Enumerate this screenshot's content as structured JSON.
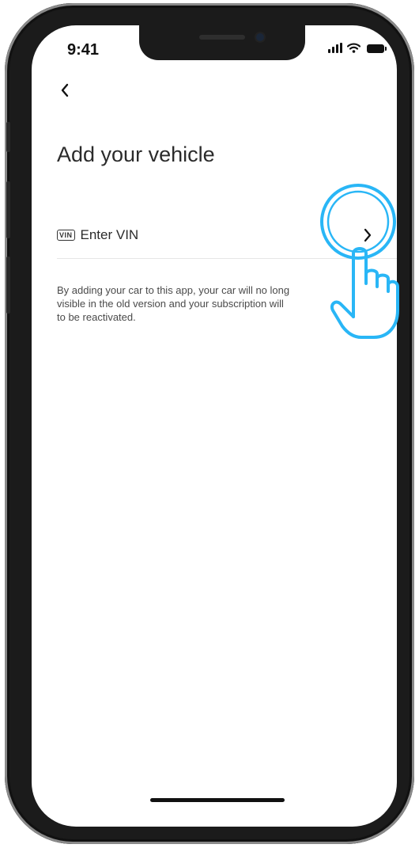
{
  "status_bar": {
    "time": "9:41",
    "icons": [
      "cellular-signal-icon",
      "wifi-icon",
      "battery-icon"
    ]
  },
  "header": {
    "back_icon": "chevron-left-icon",
    "title": "Add your vehicle"
  },
  "vin_row": {
    "badge": "VIN",
    "label": "Enter VIN",
    "chevron_icon": "chevron-right-icon"
  },
  "info": {
    "text": "By adding your car to this app, your car will no long\nvisible in the old version and your subscription will\nto be reactivated."
  },
  "overlay": {
    "tap_hint_icon": "tap-hand-icon",
    "accent_color": "#29b6f6"
  }
}
